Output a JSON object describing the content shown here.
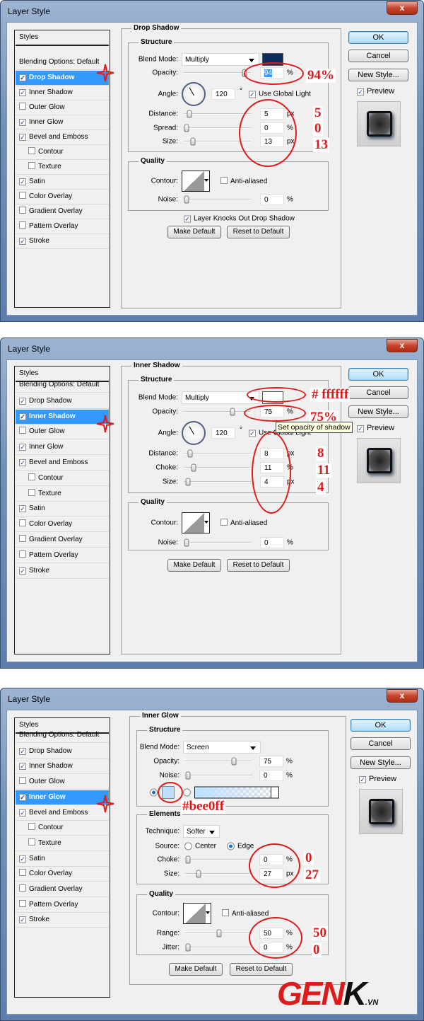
{
  "colors": {
    "annotation": "#e01a1a",
    "selection": "#3399ff",
    "drop_shadow_color": "#0f2d5a",
    "inner_shadow_color": "#ffffff",
    "inner_glow_color": "#bee0ff"
  },
  "dialogs": [
    {
      "title": "Layer Style",
      "close": "x",
      "styles_header": "Styles",
      "style_items": [
        {
          "label": "Blending Options: Default",
          "checked": null
        },
        {
          "label": "Drop Shadow",
          "checked": true,
          "selected": true
        },
        {
          "label": "Inner Shadow",
          "checked": true
        },
        {
          "label": "Outer Glow",
          "checked": false
        },
        {
          "label": "Inner Glow",
          "checked": true
        },
        {
          "label": "Bevel and Emboss",
          "checked": true
        },
        {
          "label": "Contour",
          "checked": false,
          "indent": true
        },
        {
          "label": "Texture",
          "checked": false,
          "indent": true
        },
        {
          "label": "Satin",
          "checked": true
        },
        {
          "label": "Color Overlay",
          "checked": false
        },
        {
          "label": "Gradient Overlay",
          "checked": false
        },
        {
          "label": "Pattern Overlay",
          "checked": false
        },
        {
          "label": "Stroke",
          "checked": true
        }
      ],
      "panel_title": "Drop Shadow",
      "groups": [
        {
          "title": "Structure",
          "rows": [
            {
              "type": "select",
              "label": "Blend Mode:",
              "value": "Multiply",
              "swatch": "#0f2d5a"
            },
            {
              "type": "slider",
              "label": "Opacity:",
              "value": "94",
              "unit": "%",
              "level": 94,
              "highlight": true
            },
            {
              "type": "angle",
              "label": "Angle:",
              "value": "120",
              "unit": "°",
              "check_label": "Use Global Light",
              "checked": true
            },
            {
              "type": "slider",
              "label": "Distance:",
              "value": "5",
              "unit": "px",
              "level": 5
            },
            {
              "type": "slider",
              "label": "Spread:",
              "value": "0",
              "unit": "%",
              "level": 0
            },
            {
              "type": "slider",
              "label": "Size:",
              "value": "13",
              "unit": "px",
              "level": 10
            }
          ]
        },
        {
          "title": "Quality",
          "rows": [
            {
              "type": "contour",
              "label": "Contour:",
              "check_label": "Anti-aliased",
              "checked": false
            },
            {
              "type": "slider",
              "label": "Noise:",
              "value": "0",
              "unit": "%",
              "level": 0
            }
          ]
        }
      ],
      "extra_check": {
        "label": "Layer Knocks Out Drop Shadow",
        "checked": true
      },
      "make_default": "Make Default",
      "reset_default": "Reset to Default",
      "buttons": {
        "ok": "OK",
        "cancel": "Cancel",
        "new_style": "New Style...",
        "preview": "Preview",
        "preview_checked": true
      },
      "annotations": [
        "94%",
        "5",
        "0",
        "13"
      ]
    },
    {
      "title": "Layer Style",
      "close": "x",
      "styles_header": "Styles",
      "style_items": [
        {
          "label": "Blending Options: Default",
          "checked": null
        },
        {
          "label": "Drop Shadow",
          "checked": true
        },
        {
          "label": "Inner Shadow",
          "checked": true,
          "selected": true
        },
        {
          "label": "Outer Glow",
          "checked": false
        },
        {
          "label": "Inner Glow",
          "checked": true
        },
        {
          "label": "Bevel and Emboss",
          "checked": true
        },
        {
          "label": "Contour",
          "checked": false,
          "indent": true
        },
        {
          "label": "Texture",
          "checked": false,
          "indent": true
        },
        {
          "label": "Satin",
          "checked": true
        },
        {
          "label": "Color Overlay",
          "checked": false
        },
        {
          "label": "Gradient Overlay",
          "checked": false
        },
        {
          "label": "Pattern Overlay",
          "checked": false
        },
        {
          "label": "Stroke",
          "checked": true
        }
      ],
      "panel_title": "Inner Shadow",
      "groups": [
        {
          "title": "Structure",
          "rows": [
            {
              "type": "select",
              "label": "Blend Mode:",
              "value": "Multiply",
              "swatch": "#ffffff"
            },
            {
              "type": "slider",
              "label": "Opacity:",
              "value": "75",
              "unit": "%",
              "level": 75
            },
            {
              "type": "angle",
              "label": "Angle:",
              "value": "120",
              "unit": "°",
              "check_label": "Use Global Light",
              "checked": true
            },
            {
              "type": "slider",
              "label": "Distance:",
              "value": "8",
              "unit": "px",
              "level": 6
            },
            {
              "type": "slider",
              "label": "Choke:",
              "value": "11",
              "unit": "%",
              "level": 11
            },
            {
              "type": "slider",
              "label": "Size:",
              "value": "4",
              "unit": "px",
              "level": 2
            }
          ]
        },
        {
          "title": "Quality",
          "rows": [
            {
              "type": "contour",
              "label": "Contour:",
              "check_label": "Anti-aliased",
              "checked": false
            },
            {
              "type": "slider",
              "label": "Noise:",
              "value": "0",
              "unit": "%",
              "level": 0
            }
          ]
        }
      ],
      "tooltip": "Set opacity of shadow",
      "make_default": "Make Default",
      "reset_default": "Reset to Default",
      "buttons": {
        "ok": "OK",
        "cancel": "Cancel",
        "new_style": "New Style...",
        "preview": "Preview",
        "preview_checked": true
      },
      "annotations": [
        "# ffffff",
        "75%",
        "8",
        "11",
        "4"
      ]
    },
    {
      "title": "Layer Style",
      "close": "x",
      "styles_header": "Styles",
      "style_items": [
        {
          "label": "Blending Options: Default",
          "checked": null
        },
        {
          "label": "Drop Shadow",
          "checked": true
        },
        {
          "label": "Inner Shadow",
          "checked": true
        },
        {
          "label": "Outer Glow",
          "checked": false
        },
        {
          "label": "Inner Glow",
          "checked": true,
          "selected": true
        },
        {
          "label": "Bevel and Emboss",
          "checked": true
        },
        {
          "label": "Contour",
          "checked": false,
          "indent": true
        },
        {
          "label": "Texture",
          "checked": false,
          "indent": true
        },
        {
          "label": "Satin",
          "checked": true
        },
        {
          "label": "Color Overlay",
          "checked": false
        },
        {
          "label": "Gradient Overlay",
          "checked": false
        },
        {
          "label": "Pattern Overlay",
          "checked": false
        },
        {
          "label": "Stroke",
          "checked": true
        }
      ],
      "panel_title": "Inner Glow",
      "groups": [
        {
          "title": "Structure",
          "rows": [
            {
              "type": "select",
              "label": "Blend Mode:",
              "value": "Screen"
            },
            {
              "type": "slider",
              "label": "Opacity:",
              "value": "75",
              "unit": "%",
              "level": 75
            },
            {
              "type": "slider",
              "label": "Noise:",
              "value": "0",
              "unit": "%",
              "level": 0
            },
            {
              "type": "colorpick",
              "swatch": "#bee0ff",
              "mode": "solid"
            }
          ]
        },
        {
          "title": "Elements",
          "rows": [
            {
              "type": "select",
              "label": "Technique:",
              "value": "Softer",
              "short": true
            },
            {
              "type": "radio",
              "label": "Source:",
              "options": [
                "Center",
                "Edge"
              ],
              "selected": "Edge"
            },
            {
              "type": "slider",
              "label": "Choke:",
              "value": "0",
              "unit": "%",
              "level": 0
            },
            {
              "type": "slider",
              "label": "Size:",
              "value": "27",
              "unit": "px",
              "level": 17
            }
          ]
        },
        {
          "title": "Quality",
          "rows": [
            {
              "type": "contour",
              "label": "Contour:",
              "check_label": "Anti-aliased",
              "checked": false
            },
            {
              "type": "slider",
              "label": "Range:",
              "value": "50",
              "unit": "%",
              "level": 50
            },
            {
              "type": "slider",
              "label": "Jitter:",
              "value": "0",
              "unit": "%",
              "level": 0
            }
          ]
        }
      ],
      "make_default": "Make Default",
      "reset_default": "Reset to Default",
      "buttons": {
        "ok": "OK",
        "cancel": "Cancel",
        "new_style": "New Style...",
        "preview": "Preview",
        "preview_checked": true
      },
      "annotations": [
        "#bee0ff",
        "0",
        "27",
        "50",
        "0"
      ]
    }
  ],
  "watermark": {
    "logo_text": "GENK",
    "suffix": ".VN"
  }
}
